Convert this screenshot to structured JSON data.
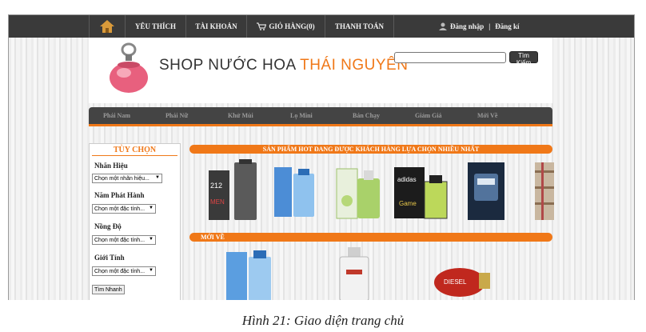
{
  "topnav": {
    "favorites": "YÊU THÍCH",
    "account": "TÀI KHOẢN",
    "cart": "GIỎ HÀNG(0)",
    "checkout": "THANH TOÁN",
    "login": "Đăng nhập",
    "separator": "|",
    "register": "Đăng kí"
  },
  "header": {
    "shop_name": "SHOP NƯỚC HOA",
    "shop_city": "THÁI NGUYÊN",
    "search_value": "",
    "search_button": "Tìm Kiếm"
  },
  "categories": [
    "Phái Nam",
    "Phái Nữ",
    "Khử Mùi",
    "Lọ Mini",
    "Bán Chạy",
    "Giảm Giá",
    "Mới Về"
  ],
  "sidebar": {
    "title": "TÙY CHỌN",
    "brand_label": "Nhãn Hiệu",
    "brand_select": "Chọn một nhãn hiệu...",
    "year_label": "Năm Phát Hành",
    "year_select": "Chọn một đặc tính...",
    "strength_label": "Nồng Độ",
    "strength_select": "Chọn một đặc tính...",
    "gender_label": "Giới Tính",
    "gender_select": "Chọn một đặc tính...",
    "search_button": "Tìm Nhanh"
  },
  "sections": {
    "hot": "SẢN PHẨM HOT ĐANG ĐƯỢC KHÁCH HÀNG LỰA CHỌN NHIỀU NHẤT",
    "new": "MỚI VỀ"
  },
  "products": {
    "p212": "212",
    "p212_sub": "MEN",
    "adidas": "adidas",
    "adidas_sub": "Game",
    "diesel": "DIESEL"
  },
  "caption": "Hình 21: Giao diện trang chủ",
  "colors": {
    "accent": "#f07818",
    "bar": "#3a3a3a"
  },
  "icons": [
    "home-icon",
    "cart-icon",
    "user-icon",
    "chevron-down-icon"
  ]
}
